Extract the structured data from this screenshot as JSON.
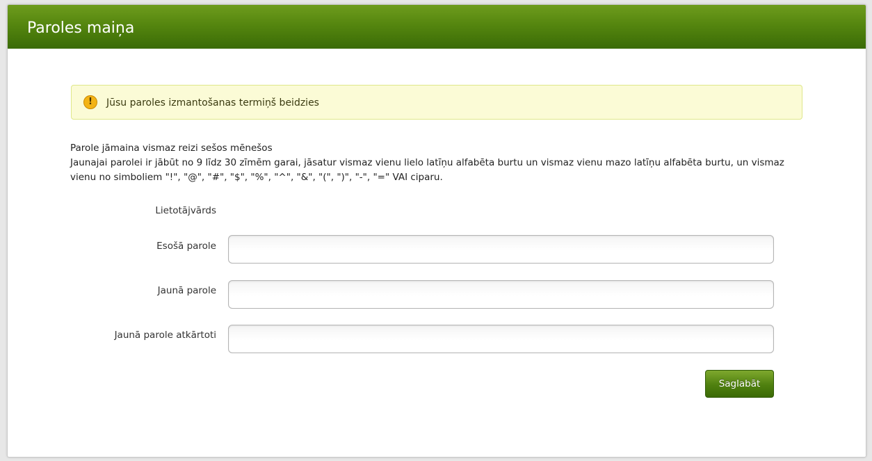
{
  "header": {
    "title": "Paroles maiņa"
  },
  "alert": {
    "icon": "warning-icon",
    "symbol": "!",
    "text": "Jūsu paroles izmantošanas termiņš beidzies"
  },
  "info": {
    "line1": "Parole jāmaina vismaz reizi sešos mēnešos",
    "line2": "Jaunajai parolei ir jābūt no 9 līdz 30 zīmēm garai, jāsatur vismaz vienu lielo latīņu alfabēta burtu un vismaz vienu mazo latīņu alfabēta burtu, un vismaz vienu no simboliem \"!\", \"@\", \"#\", \"$\", \"%\", \"^\", \"&\", \"(\", \")\", \"-\", \"=\" VAI ciparu."
  },
  "form": {
    "username_label": "Lietotājvārds",
    "username_value": "",
    "current_password_label": "Esošā parole",
    "current_password_value": "",
    "new_password_label": "Jaunā parole",
    "new_password_value": "",
    "repeat_password_label": "Jaunā parole atkārtoti",
    "repeat_password_value": "",
    "save_label": "Saglabāt"
  },
  "colors": {
    "header_green": "#55860f",
    "alert_background": "#fbfbd6",
    "warning_icon": "#f3b315",
    "button_green": "#4f800f"
  }
}
